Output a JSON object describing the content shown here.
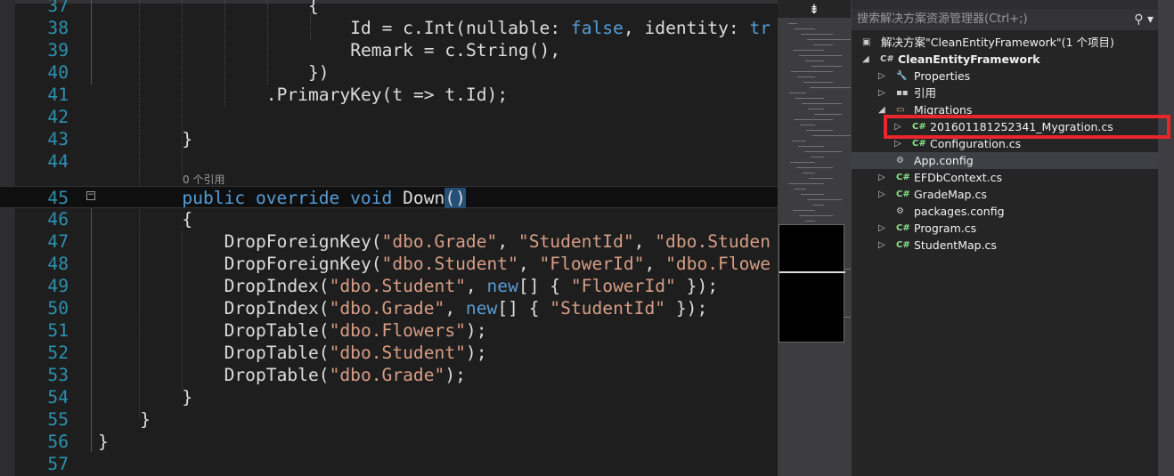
{
  "editor": {
    "codelens": "0 个引用",
    "lines": [
      {
        "num": "37",
        "indent": 20,
        "tokens": [
          [
            "{",
            "pl"
          ]
        ]
      },
      {
        "num": "38",
        "indent": 24,
        "tokens": [
          [
            "Id = c.Int(nullable: ",
            "pl"
          ],
          [
            "false",
            "kw"
          ],
          [
            ", identity: ",
            "pl"
          ],
          [
            "tr",
            "kw"
          ]
        ]
      },
      {
        "num": "39",
        "indent": 24,
        "tokens": [
          [
            "Remark = c.String(),",
            "pl"
          ]
        ]
      },
      {
        "num": "40",
        "indent": 20,
        "tokens": [
          [
            "})",
            "pl"
          ]
        ]
      },
      {
        "num": "41",
        "indent": 16,
        "tokens": [
          [
            ".PrimaryKey(t => t.Id);",
            "pl"
          ]
        ]
      },
      {
        "num": "42",
        "indent": 0,
        "tokens": []
      },
      {
        "num": "43",
        "indent": 8,
        "tokens": [
          [
            "}",
            "pl"
          ]
        ]
      },
      {
        "num": "44",
        "indent": 0,
        "tokens": []
      },
      {
        "num": "45",
        "indent": 8,
        "current": true,
        "tokens": [
          [
            "public",
            "kw"
          ],
          [
            " ",
            "pl"
          ],
          [
            "override",
            "kw"
          ],
          [
            " ",
            "pl"
          ],
          [
            "void",
            "kw"
          ],
          [
            " Down",
            "pl"
          ],
          [
            "()",
            "hl"
          ]
        ]
      },
      {
        "num": "46",
        "indent": 8,
        "tokens": [
          [
            "{",
            "pl"
          ]
        ]
      },
      {
        "num": "47",
        "indent": 12,
        "tokens": [
          [
            "DropForeignKey(",
            "pl"
          ],
          [
            "\"dbo.Grade\"",
            "str"
          ],
          [
            ", ",
            "pl"
          ],
          [
            "\"StudentId\"",
            "str"
          ],
          [
            ", ",
            "pl"
          ],
          [
            "\"dbo.Studen",
            "str"
          ]
        ]
      },
      {
        "num": "48",
        "indent": 12,
        "tokens": [
          [
            "DropForeignKey(",
            "pl"
          ],
          [
            "\"dbo.Student\"",
            "str"
          ],
          [
            ", ",
            "pl"
          ],
          [
            "\"FlowerId\"",
            "str"
          ],
          [
            ", ",
            "pl"
          ],
          [
            "\"dbo.Flowe",
            "str"
          ]
        ]
      },
      {
        "num": "49",
        "indent": 12,
        "tokens": [
          [
            "DropIndex(",
            "pl"
          ],
          [
            "\"dbo.Student\"",
            "str"
          ],
          [
            ", ",
            "pl"
          ],
          [
            "new",
            "kw"
          ],
          [
            "[] { ",
            "pl"
          ],
          [
            "\"FlowerId\"",
            "str"
          ],
          [
            " });",
            "pl"
          ]
        ]
      },
      {
        "num": "50",
        "indent": 12,
        "tokens": [
          [
            "DropIndex(",
            "pl"
          ],
          [
            "\"dbo.Grade\"",
            "str"
          ],
          [
            ", ",
            "pl"
          ],
          [
            "new",
            "kw"
          ],
          [
            "[] { ",
            "pl"
          ],
          [
            "\"StudentId\"",
            "str"
          ],
          [
            " });",
            "pl"
          ]
        ]
      },
      {
        "num": "51",
        "indent": 12,
        "tokens": [
          [
            "DropTable(",
            "pl"
          ],
          [
            "\"dbo.Flowers\"",
            "str"
          ],
          [
            ");",
            "pl"
          ]
        ]
      },
      {
        "num": "52",
        "indent": 12,
        "tokens": [
          [
            "DropTable(",
            "pl"
          ],
          [
            "\"dbo.Student\"",
            "str"
          ],
          [
            ");",
            "pl"
          ]
        ]
      },
      {
        "num": "53",
        "indent": 12,
        "tokens": [
          [
            "DropTable(",
            "pl"
          ],
          [
            "\"dbo.Grade\"",
            "str"
          ],
          [
            ");",
            "pl"
          ]
        ]
      },
      {
        "num": "54",
        "indent": 8,
        "tokens": [
          [
            "}",
            "pl"
          ]
        ]
      },
      {
        "num": "55",
        "indent": 4,
        "tokens": [
          [
            "}",
            "pl"
          ]
        ]
      },
      {
        "num": "56",
        "indent": 0,
        "tokens": [
          [
            "}",
            "pl"
          ]
        ]
      },
      {
        "num": "57",
        "indent": 0,
        "tokens": []
      }
    ]
  },
  "minimap": {
    "split_icon": "⇟"
  },
  "solution_explorer": {
    "search_placeholder": "搜索解决方案资源管理器(Ctrl+;)",
    "search_icon": "⚲ ▾",
    "items": [
      {
        "label": "解决方案\"CleanEntityFramework\"(1 个项目)",
        "icon": "▣",
        "icon_color": "#ccc",
        "level": 0,
        "twisty": ""
      },
      {
        "label": "CleanEntityFramework",
        "icon": "C#",
        "icon_color": "#ccc",
        "level": 1,
        "twisty": "◢",
        "bold": true
      },
      {
        "label": "Properties",
        "icon": "🔧",
        "icon_color": "#ccc",
        "level": 2,
        "twisty": "▷"
      },
      {
        "label": "引用",
        "icon": "▪▪",
        "icon_color": "#ccc",
        "level": 2,
        "twisty": "▷"
      },
      {
        "label": "Migrations",
        "icon": "▭",
        "icon_color": "#dcb67a",
        "level": 2,
        "twisty": "◢"
      },
      {
        "label": "201601181252341_Mygration.cs",
        "icon": "C#",
        "icon_color": "#8ae28a",
        "level": 3,
        "twisty": "▷"
      },
      {
        "label": "Configuration.cs",
        "icon": "C#",
        "icon_color": "#8ae28a",
        "level": 3,
        "twisty": "▷"
      },
      {
        "label": "App.config",
        "icon": "⚙",
        "icon_color": "#ccc",
        "level": 2,
        "twisty": "",
        "selected": true
      },
      {
        "label": "EFDbContext.cs",
        "icon": "C#",
        "icon_color": "#8ae28a",
        "level": 2,
        "twisty": "▷"
      },
      {
        "label": "GradeMap.cs",
        "icon": "C#",
        "icon_color": "#8ae28a",
        "level": 2,
        "twisty": "▷"
      },
      {
        "label": "packages.config",
        "icon": "⚙",
        "icon_color": "#ccc",
        "level": 2,
        "twisty": ""
      },
      {
        "label": "Program.cs",
        "icon": "C#",
        "icon_color": "#8ae28a",
        "level": 2,
        "twisty": "▷"
      },
      {
        "label": "StudentMap.cs",
        "icon": "C#",
        "icon_color": "#8ae28a",
        "level": 2,
        "twisty": "▷"
      }
    ]
  },
  "highlight_color": "#e8262b"
}
